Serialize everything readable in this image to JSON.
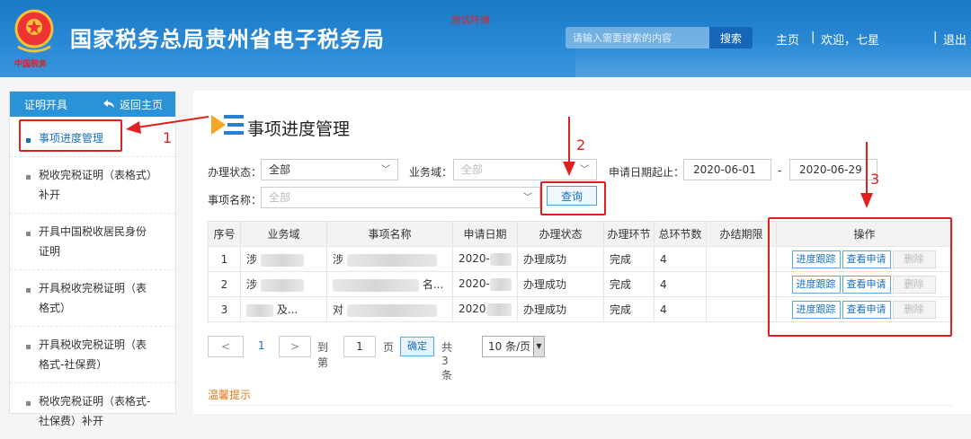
{
  "header": {
    "site_title": "国家税务总局贵州省电子税务局",
    "test_env": "测试环境",
    "search_placeholder": "请输入需要搜索的内容",
    "search_button": "搜索",
    "home": "主页",
    "separator": "|",
    "welcome": "欢迎，七星",
    "logout": "退出"
  },
  "sidebar": {
    "title": "证明开具",
    "back": "返回主页",
    "items": [
      {
        "label": "事项进度管理"
      },
      {
        "label": "税收完税证明（表格式）补开"
      },
      {
        "label": "开具中国税收居民身份证明"
      },
      {
        "label": "开具税收完税证明（表格式）"
      },
      {
        "label": "开具税收完税证明（表格式-社保费）"
      },
      {
        "label": "税收完税证明（表格式-社保费）补开"
      }
    ]
  },
  "main": {
    "page_title": "事项进度管理",
    "filters": {
      "status_label": "办理状态：",
      "status_value": "全部",
      "domain_label": "业务域：",
      "domain_value": "全部",
      "date_label": "申请日期起止：",
      "date_from": "2020-06-01",
      "date_sep": "-",
      "date_to": "2020-06-29",
      "item_label": "事项名称：",
      "item_value": "全部",
      "query_button": "查询"
    },
    "table": {
      "headers": [
        "序号",
        "业务域",
        "事项名称",
        "申请日期",
        "办理状态",
        "办理环节",
        "总环节数",
        "办结期限",
        "操作"
      ],
      "rows": [
        {
          "no": "1",
          "domain": "涉",
          "item": "涉",
          "date": "2020-",
          "status": "办理成功",
          "stage": "完成",
          "total": "4",
          "deadline": ""
        },
        {
          "no": "2",
          "domain": "涉",
          "item": "名...",
          "date": "2020-",
          "status": "办理成功",
          "stage": "完成",
          "total": "4",
          "deadline": ""
        },
        {
          "no": "3",
          "domain": "及...",
          "item": "对",
          "date": "2020",
          "status": "办理成功",
          "stage": "完成",
          "total": "4",
          "deadline": ""
        }
      ],
      "actions": {
        "track": "进度跟踪",
        "view": "查看申请",
        "delete": "删除"
      }
    },
    "pager": {
      "prev": "<",
      "page": "1",
      "next": ">",
      "goto": "到第",
      "goto_value": "1",
      "page_unit": "页",
      "confirm": "确定",
      "total": "共 3 条",
      "page_size": "10 条/页"
    },
    "tips": "温馨提示"
  },
  "annotations": {
    "one": "1",
    "two": "2",
    "three": "3"
  },
  "colors": {
    "header_blue": "#2b8ad6",
    "accent_blue": "#1a6fc2",
    "annotation_red": "#e02020",
    "tips_orange": "#e07b1a"
  }
}
